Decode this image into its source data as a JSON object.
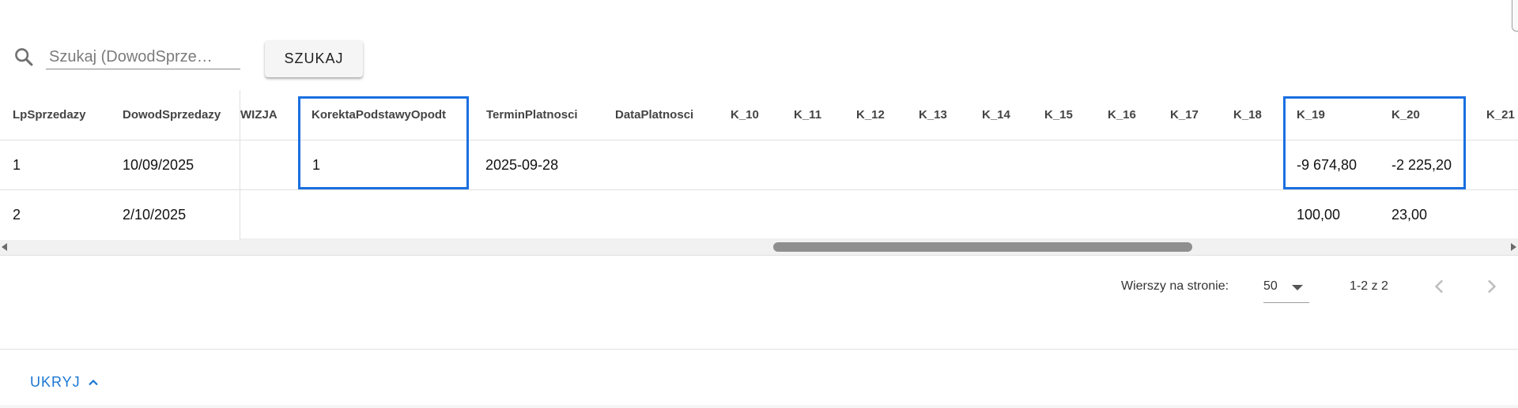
{
  "search": {
    "placeholder": "Szukaj (DowodSprze…",
    "value": "",
    "button_label": "SZUKAJ"
  },
  "table": {
    "pinned_columns": [
      "LpSprzedazy",
      "DowodSprzedazy"
    ],
    "scroll_columns": [
      "WIZJA",
      "KorektaPodstawyOpodt",
      "TerminPlatnosci",
      "DataPlatnosci",
      "K_10",
      "K_11",
      "K_12",
      "K_13",
      "K_14",
      "K_15",
      "K_16",
      "K_17",
      "K_18",
      "K_19",
      "K_20",
      "K_21"
    ],
    "rows": [
      {
        "LpSprzedazy": "1",
        "DowodSprzedazy": "10/09/2025",
        "WIZJA": "",
        "KorektaPodstawyOpodt": "1",
        "TerminPlatnosci": "2025-09-28",
        "DataPlatnosci": "",
        "K_19": "-9 674,80",
        "K_20": "-2 225,20",
        "K_21": ""
      },
      {
        "LpSprzedazy": "2",
        "DowodSprzedazy": "2/10/2025",
        "WIZJA": "",
        "KorektaPodstawyOpodt": "",
        "TerminPlatnosci": "",
        "DataPlatnosci": "",
        "K_19": "100,00",
        "K_20": "23,00",
        "K_21": ""
      }
    ],
    "highlight_color": "#1a6fe0"
  },
  "pagination": {
    "rows_per_page_label": "Wierszy na stronie:",
    "rows_per_page_value": "50",
    "range": "1-2 z 2",
    "prev_icon": "chevron-left-icon",
    "next_icon": "chevron-right-icon"
  },
  "footer": {
    "toggle_label": "UKRYJ",
    "toggle_icon": "chevron-up-icon",
    "accent_color": "#1976d2"
  }
}
